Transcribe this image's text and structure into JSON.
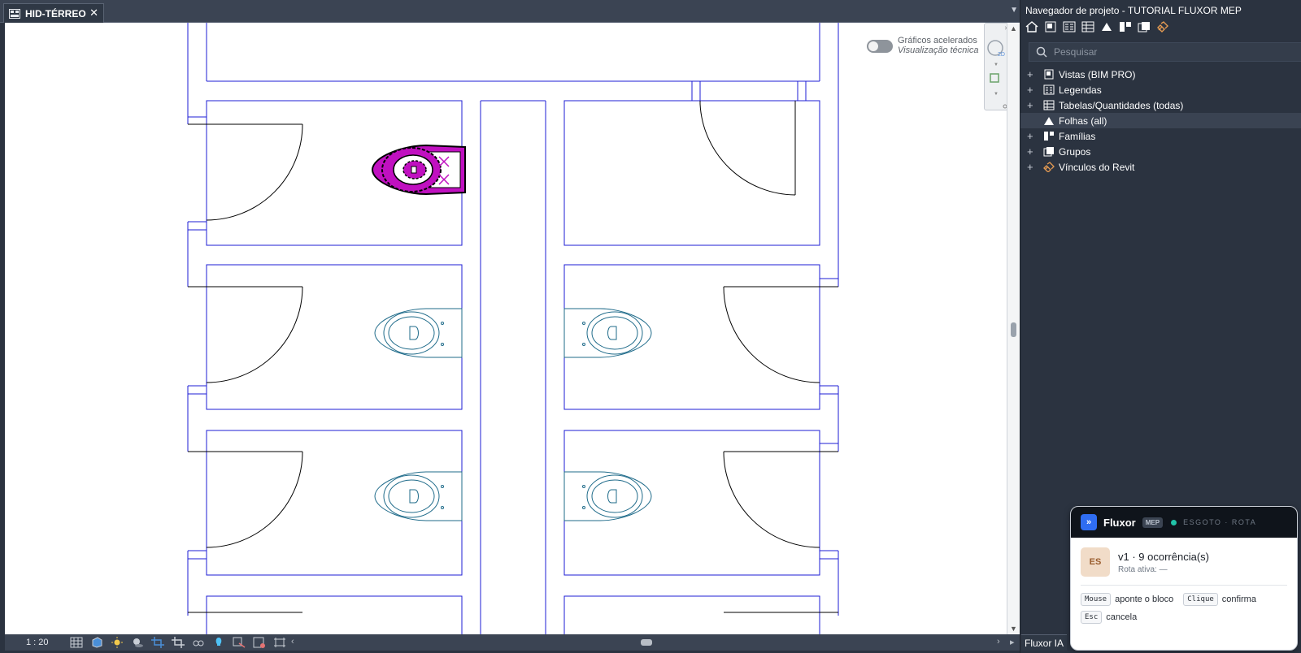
{
  "document_tab": {
    "label": "HID-TÉRREO",
    "close": "✕"
  },
  "canvas": {
    "accelerated_graphics_label": "Gráficos acelerados",
    "visual_style_label": "Visualização técnica"
  },
  "status_bar": {
    "scale": "1 : 20"
  },
  "project_browser": {
    "title": "Navegador de projeto - TUTORIAL FLUXOR MEP",
    "search_placeholder": "Pesquisar",
    "items": [
      {
        "label": "Vistas (BIM PRO)",
        "expander": "+",
        "icon": "views-icon"
      },
      {
        "label": "Legendas",
        "expander": "+",
        "icon": "legends-icon"
      },
      {
        "label": "Tabelas/Quantidades (todas)",
        "expander": "+",
        "icon": "schedules-icon"
      },
      {
        "label": "Folhas (all)",
        "expander": "",
        "icon": "sheets-icon"
      },
      {
        "label": "Famílias",
        "expander": "+",
        "icon": "families-icon"
      },
      {
        "label": "Grupos",
        "expander": "+",
        "icon": "groups-icon"
      },
      {
        "label": "Vínculos do Revit",
        "expander": "+",
        "icon": "revit-links-icon"
      }
    ]
  },
  "bottom_tab": {
    "label": "Fluxor IA"
  },
  "fluxor": {
    "title": "Fluxor",
    "badge": "MEP",
    "status": "ESGOTO · ROTA",
    "avatar": "ES",
    "version_line": "v1  ·  9 ocorrência(s)",
    "active_route": "Rota ativa: —",
    "hints": [
      {
        "key": "Mouse",
        "text": "aponte o bloco"
      },
      {
        "key": "Clique",
        "text": "confirma"
      },
      {
        "key": "Esc",
        "text": "cancela"
      }
    ]
  },
  "colors": {
    "wall_blue": "#1c1cd6",
    "fixture_teal": "#1f6b8a",
    "selected_magenta": "#c010c0",
    "panel_dark": "#2b3340"
  }
}
